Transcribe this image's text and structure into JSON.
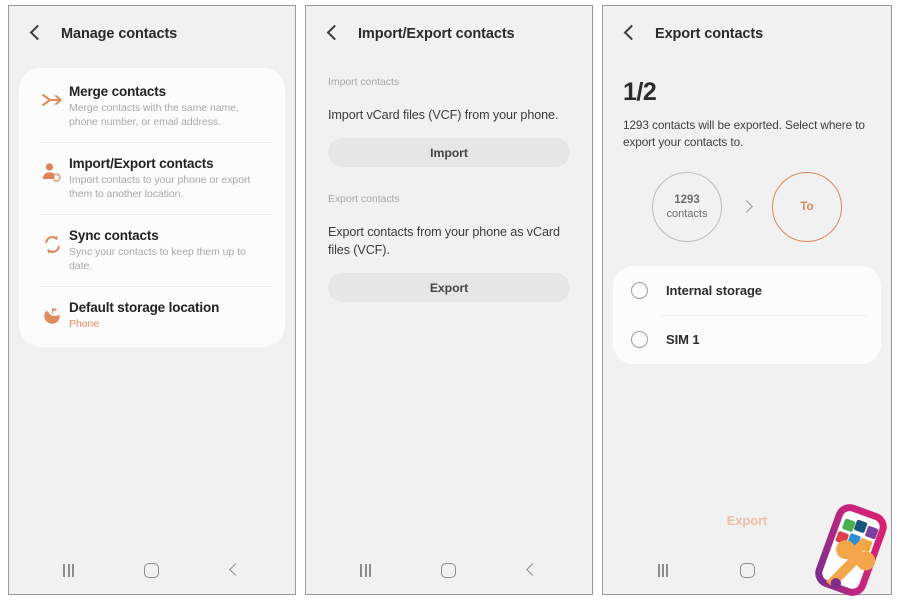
{
  "accent": {
    "orange": "#e98a5e",
    "orange_strong": "#e0855a",
    "export_disabled": "#f0bfa3",
    "page_bg": "#f1f1f1",
    "card_bg": "#fcfcfc",
    "button_bg": "#e6e6e6"
  },
  "nav": {
    "recents_icon": "recent-apps-icon",
    "home_icon": "home-icon",
    "back_icon": "back-icon"
  },
  "panel1": {
    "title": "Manage contacts",
    "back_icon": "chevron-left-icon",
    "rows": [
      {
        "icon": "merge-arrows-icon",
        "title": "Merge contacts",
        "sub": "Merge contacts with the same name, phone number, or email address.",
        "sub_accent": false
      },
      {
        "icon": "person-sync-icon",
        "title": "Import/Export contacts",
        "sub": "Import contacts to your phone or export them to another location.",
        "sub_accent": false
      },
      {
        "icon": "sync-arrows-icon",
        "title": "Sync contacts",
        "sub": "Sync your contacts to keep them up to date.",
        "sub_accent": false
      },
      {
        "icon": "storage-pie-icon",
        "title": "Default storage location",
        "sub": "Phone",
        "sub_accent": true
      }
    ]
  },
  "panel2": {
    "title": "Import/Export contacts",
    "back_icon": "chevron-left-icon",
    "import_section": {
      "label": "Import contacts",
      "description": "Import vCard files (VCF) from your phone.",
      "button": "Import"
    },
    "export_section": {
      "label": "Export contacts",
      "description": "Export contacts from your phone as vCard files (VCF).",
      "button": "Export"
    }
  },
  "panel3": {
    "title": "Export contacts",
    "back_icon": "chevron-left-icon",
    "step": "1/2",
    "description": "1293 contacts will be exported. Select where to export your contacts to.",
    "source_circle": {
      "count": "1293",
      "label": "contacts"
    },
    "arrow_icon": "chevron-right-icon",
    "target_circle": {
      "label": "To"
    },
    "destinations": [
      {
        "label": "Internal storage",
        "selected": false
      },
      {
        "label": "SIM 1",
        "selected": false
      }
    ],
    "cta": "Export"
  },
  "watermark": {
    "icon": "phone-with-wrench-icon",
    "tile_colors": [
      "#4caf50",
      "#18567e",
      "#7b3f9d",
      "#e0404b",
      "#2d8fd5",
      "#f5a623",
      "#35c4c4",
      "#f5a623"
    ],
    "phone_border": "#c9247e",
    "wrench_color": "#f5a64a"
  }
}
